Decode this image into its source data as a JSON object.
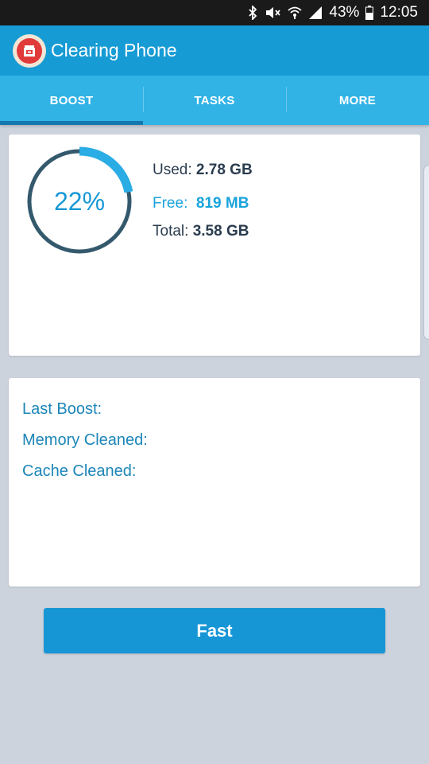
{
  "status_bar": {
    "battery": "43%",
    "time": "12:05",
    "icons": [
      "bluetooth-icon",
      "mute-icon",
      "wifi-icon",
      "signal-icon",
      "battery-icon"
    ]
  },
  "app_bar": {
    "title": "Clearing Phone",
    "logo_icon": "app-logo-icon"
  },
  "tabs": [
    {
      "label": "BOOST",
      "active": true
    },
    {
      "label": "TASKS",
      "active": false
    },
    {
      "label": "MORE",
      "active": false
    }
  ],
  "memory": {
    "percent_label": "22%",
    "ring_fraction": 0.22,
    "used_label": "Used:",
    "used_value": "2.78 GB",
    "free_label": "Free:",
    "free_value": "819 MB",
    "total_label": "Total:",
    "total_value": "3.58 GB"
  },
  "stats": {
    "last_boost": "Last Boost:",
    "memory_cleaned": "Memory Cleaned:",
    "cache_cleaned": "Cache Cleaned:"
  },
  "action": {
    "fast_label": "Fast"
  },
  "colors": {
    "app_bar": "#169bd4",
    "tabs": "#32b3e6",
    "tab_indicator": "#1577b0",
    "ring_track": "#34596d",
    "ring_progress": "#2aace4",
    "button": "#1796d6",
    "background": "#cdd3dd"
  }
}
